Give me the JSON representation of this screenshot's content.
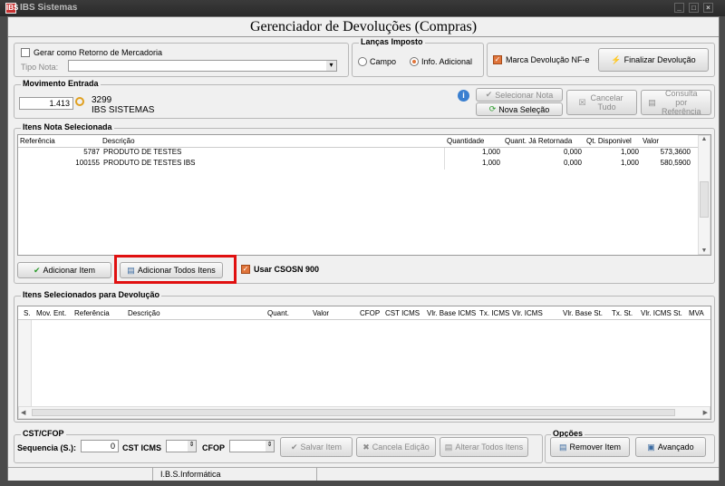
{
  "window": {
    "title": "IBS Sistemas",
    "logo_text": "IBS",
    "minimize": "_",
    "maximize": "□",
    "close": "×"
  },
  "header": {
    "title": "Gerenciador de Devoluções (Compras)"
  },
  "top": {
    "gerar_label": "Gerar como Retorno de Mercadoria",
    "tipo_nota_label": "Tipo Nota:",
    "tipo_nota_value": "",
    "tipo_nota_arrow": "▾"
  },
  "lancas": {
    "title": "Lanças Imposto",
    "campo": "Campo",
    "info": "Info. Adicional"
  },
  "marca": {
    "label": "Marca Devolução NF-e",
    "checked": true
  },
  "finalizar": {
    "label": "Finalizar Devolução"
  },
  "movimento": {
    "title": "Movimento Entrada",
    "value": "1.413",
    "code": "3299",
    "name": "IBS SISTEMAS",
    "info_icon": "i"
  },
  "actions": {
    "selecionar": "Selecionar Nota",
    "nova": "Nova Seleção",
    "cancelar": "Cancelar Tudo",
    "consulta": "Consulta por Referência"
  },
  "itens": {
    "title": "Itens Nota Selecionada",
    "columns": [
      "Referência",
      "Descrição",
      "Quantidade",
      "Quant. Já Retornada",
      "Qt. Disponivel",
      "Valor"
    ],
    "rows": [
      {
        "ref": "5787",
        "desc": "PRODUTO DE TESTES",
        "qtd": "1,000",
        "ret": "0,000",
        "disp": "1,000",
        "valor": "573,3600"
      },
      {
        "ref": "100155",
        "desc": "PRODUTO DE TESTES IBS",
        "qtd": "1,000",
        "ret": "0,000",
        "disp": "1,000",
        "valor": "580,5900"
      }
    ],
    "scroll_up": "▲",
    "scroll_down": "▼"
  },
  "buttons": {
    "adicionar": "Adicionar Item",
    "adicionar_todos": "Adicionar Todos Itens",
    "usar_csosn": "Usar CSOSN 900"
  },
  "selecionados": {
    "title": "Itens Selecionados para Devolução",
    "columns": [
      "S.",
      "Mov. Ent.",
      "Referência",
      "Descrição",
      "Quant.",
      "Valor",
      "CFOP",
      "CST ICMS",
      "Vlr. Base ICMS",
      "Tx. ICMS",
      "Vlr. ICMS",
      "Vlr. Base St.",
      "Tx. St.",
      "Vlr. ICMS St.",
      "MVA"
    ],
    "scroll_left": "◀",
    "scroll_right": "▶"
  },
  "cst": {
    "title": "CST/CFOP",
    "sequencia_label": "Sequencia (S.):",
    "sequencia_value": "0",
    "cst_label": "CST ICMS",
    "cfop_label": "CFOP",
    "spin": "⇕",
    "salvar": "Salvar Item",
    "cancela": "Cancela Edição",
    "alterar": "Alterar Todos Itens"
  },
  "opcoes": {
    "title": "Opções",
    "remover": "Remover Item",
    "avancado": "Avançado"
  },
  "status": {
    "text": "I.B.S.Informática"
  }
}
